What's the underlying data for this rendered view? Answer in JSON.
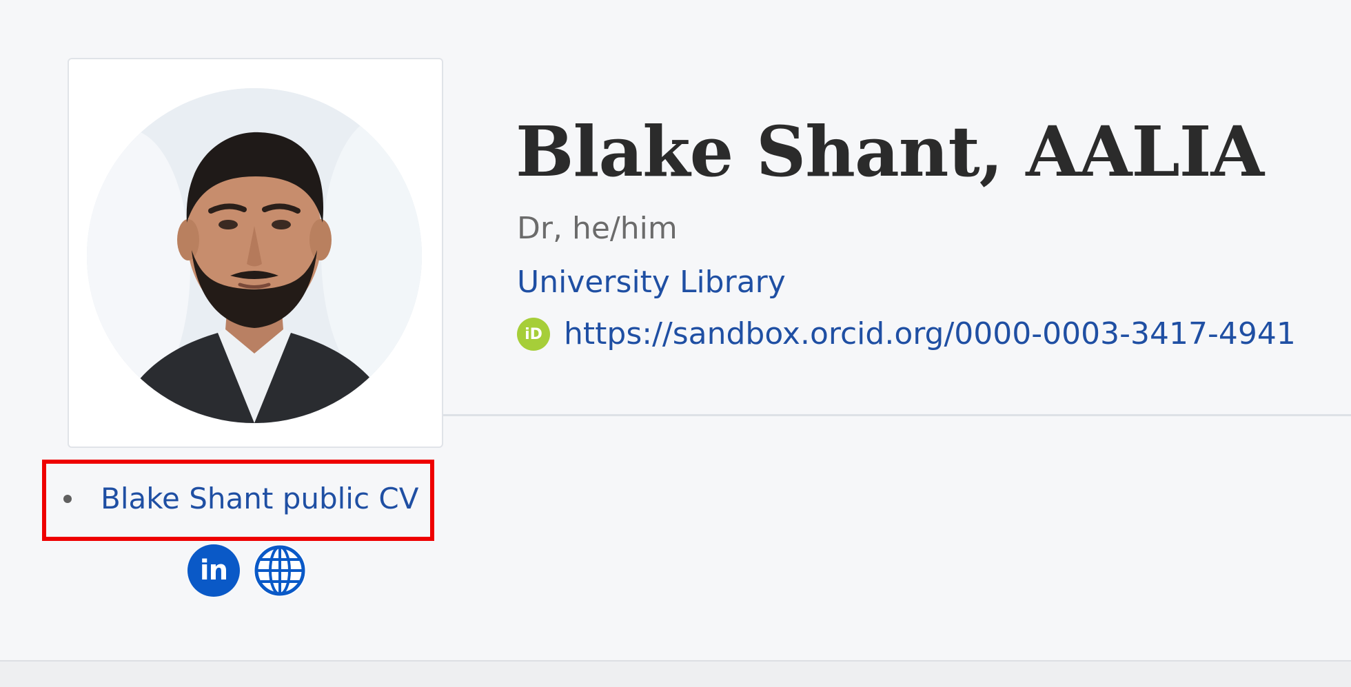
{
  "profile": {
    "name": "Blake Shant, AALIA",
    "title_pronouns": "Dr, he/him",
    "organization": "University Library",
    "orcid_url": "https://sandbox.orcid.org/0000-0003-3417-4941",
    "orcid_icon_text": "iD",
    "avatar_icon": "person-photo"
  },
  "links": {
    "cv_label": "Blake Shant public CV"
  },
  "social": {
    "linkedin_label": "in",
    "linkedin_icon": "linkedin-icon",
    "website_icon": "globe-icon"
  },
  "colors": {
    "link": "#1f4fa3",
    "orcid_green": "#a6ce39",
    "social_blue": "#0a59c7",
    "highlight_red": "#ee0000"
  }
}
